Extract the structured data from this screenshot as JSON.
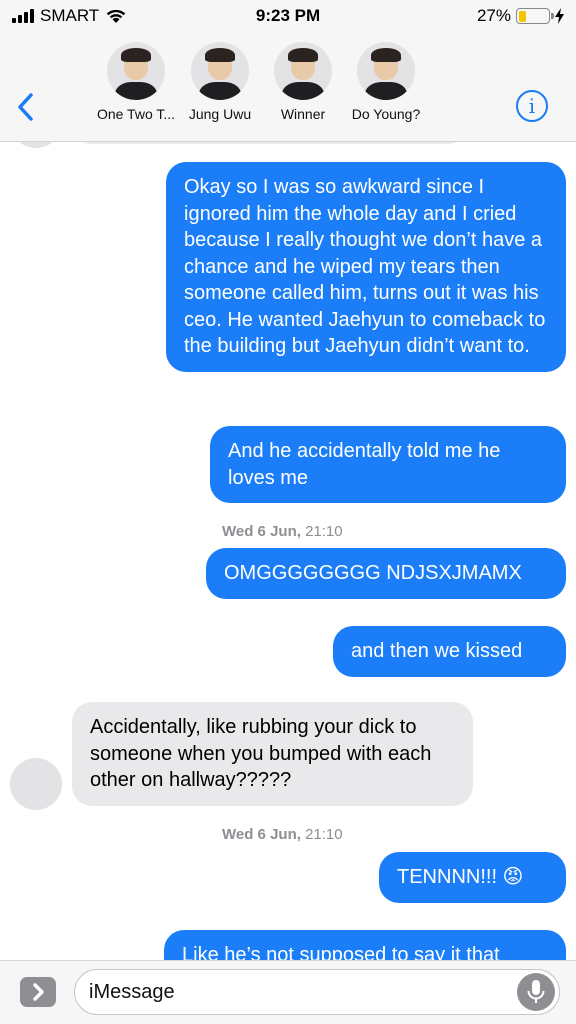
{
  "status_bar": {
    "carrier": "SMART",
    "time": "9:23 PM",
    "battery_percent": "27%",
    "battery_level": 0.27
  },
  "header": {
    "back_icon": "chevron-left-icon",
    "info_icon": "info-icon",
    "info_glyph": "i",
    "contacts": [
      {
        "name": "One Two T..."
      },
      {
        "name": "Jung Uwu"
      },
      {
        "name": "Winner"
      },
      {
        "name": "Do Young?"
      }
    ]
  },
  "messages": [
    {
      "type": "outgoing",
      "text": "Okay so I was so awkward since I ignored him the whole day and I cried because I really thought we don’t have a chance and he wiped my tears then someone called him, turns out it was his ceo. He wanted Jaehyun to comeback to the building but Jaehyun didn’t want to."
    },
    {
      "type": "outgoing",
      "text": "And he accidentally told me he loves me"
    },
    {
      "type": "timestamp",
      "day": "Wed 6 Jun,",
      "time": "21:10"
    },
    {
      "type": "outgoing",
      "text": "OMGGGGGGGG NDJSXJMAMX"
    },
    {
      "type": "outgoing",
      "text": "and then we kissed"
    },
    {
      "type": "incoming",
      "text": "Accidentally, like rubbing your dick to someone when you bumped with each other on hallway?????"
    },
    {
      "type": "timestamp",
      "day": "Wed 6 Jun,",
      "time": "21:10"
    },
    {
      "type": "outgoing",
      "text": "TENNNN!!! 😡"
    },
    {
      "type": "outgoing",
      "text": "Like he’s not supposed to say it that"
    }
  ],
  "input_bar": {
    "placeholder": "iMessage",
    "apps_icon": "chevron-right-icon",
    "mic_icon": "microphone-icon"
  },
  "colors": {
    "outgoing_bubble": "#1b7ef8",
    "incoming_bubble": "#e9e9eb",
    "accent": "#1a7cf5"
  }
}
